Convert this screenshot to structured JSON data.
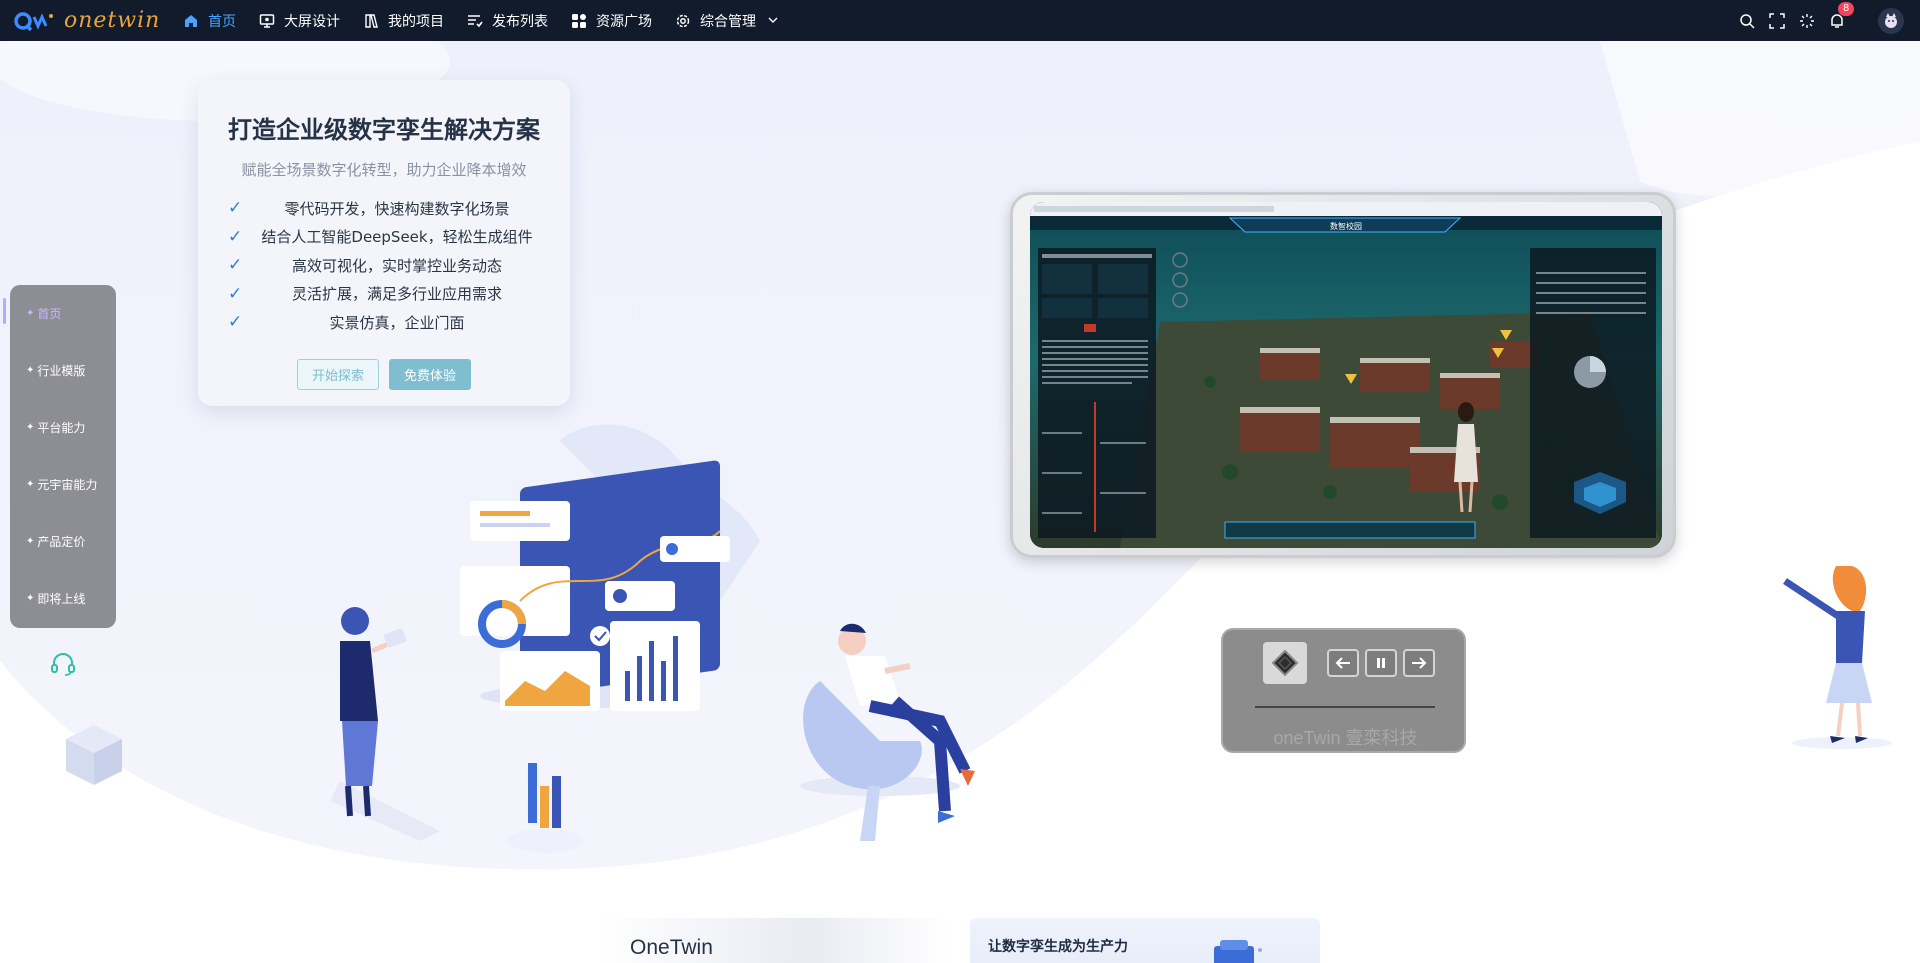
{
  "brand": {
    "logo_text": "onetwin"
  },
  "nav": {
    "items": [
      {
        "label": "首页",
        "icon": "home-icon",
        "active": true
      },
      {
        "label": "大屏设计",
        "icon": "monitor-icon"
      },
      {
        "label": "我的项目",
        "icon": "book-icon"
      },
      {
        "label": "发布列表",
        "icon": "list-icon"
      },
      {
        "label": "资源广场",
        "icon": "grid-icon"
      },
      {
        "label": "综合管理",
        "icon": "gear-icon"
      }
    ]
  },
  "topbar": {
    "notification_count": "8"
  },
  "hero": {
    "title": "打造企业级数字孪生解决方案",
    "subtitle": "赋能全场景数字化转型，助力企业降本增效",
    "features": [
      "零代码开发，快速构建数字化场景",
      "结合人工智能DeepSeek，轻松生成组件",
      "高效可视化，实时掌控业务动态",
      "灵活扩展，满足多行业应用需求",
      "实景仿真，企业门面"
    ],
    "btn_explore": "开始探索",
    "btn_trial": "免费体验"
  },
  "side_menu": {
    "items": [
      "首页",
      "行业模版",
      "平台能力",
      "元宇宙能力",
      "产品定价",
      "即将上线"
    ]
  },
  "screen": {
    "banner_title": "数智校园"
  },
  "player": {
    "label": "oneTwin 壹栾科技"
  },
  "bottom_cards": {
    "card1_title": "OneTwin",
    "card2_title": "让数字孪生成为生产力"
  },
  "colors": {
    "topbar": "#111b2b",
    "accent": "#4aa3ff",
    "logo": "#e8a33c",
    "check": "#2b7fd6"
  }
}
